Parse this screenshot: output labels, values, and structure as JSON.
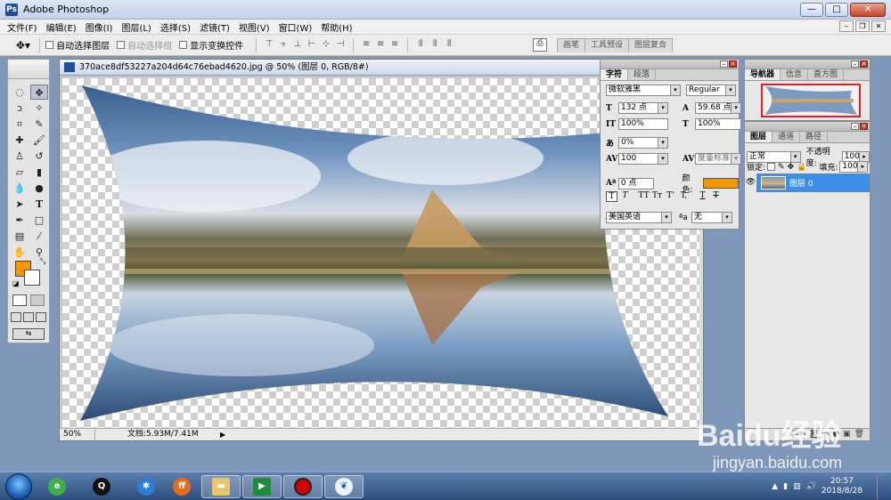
{
  "window": {
    "title": "Adobe Photoshop",
    "min": "—",
    "max": "□",
    "close": "✕"
  },
  "menu": [
    "文件(F)",
    "编辑(E)",
    "图像(I)",
    "图层(L)",
    "选择(S)",
    "滤镜(T)",
    "视图(V)",
    "窗口(W)",
    "帮助(H)"
  ],
  "options": {
    "auto_select_layer": "自动选择图层",
    "auto_select_group": "自动选择组",
    "show_transform": "显示变换控件"
  },
  "wells": [
    "画笔",
    "工具预设",
    "图层复合"
  ],
  "document": {
    "title": "370ace8df53227a204d64c76ebad4620.jpg @ 50% (图层 0, RGB/8#)",
    "zoom": "50%",
    "doc_size": "文档:5.93M/7.41M"
  },
  "character": {
    "tabs": [
      "字符",
      "段落"
    ],
    "font_family": "微软雅黑",
    "font_style": "Regular",
    "font_size": "132 点",
    "leading": "59.68 点",
    "vertical_scale": "100%",
    "horizontal_scale": "100%",
    "kerning": "0%",
    "tracking": "100",
    "kerning_mode": "度量标准",
    "baseline_shift": "0 点",
    "color_label": "颜色:",
    "color": "#f39800",
    "formats": [
      "T",
      "T",
      "TT",
      "Tт",
      "T'",
      "T,",
      "T",
      "T"
    ],
    "language": "美国英语",
    "aa_label": "ªa",
    "antialias": "无"
  },
  "navigator": {
    "tabs": [
      "导航器",
      "信息",
      "直方图"
    ]
  },
  "layers": {
    "tabs": [
      "图层",
      "通道",
      "路径"
    ],
    "blend_mode": "正常",
    "opacity_label": "不透明度:",
    "opacity": "100%",
    "lock_label": "锁定:",
    "fill_label": "填充:",
    "fill": "100%",
    "layer_name": "图层 0"
  },
  "taskbar": {
    "time": "20:57",
    "date": "2018/8/28"
  },
  "watermark": {
    "logo": "Baidu经验",
    "url": "jingyan.baidu.com"
  },
  "colors": {
    "foreground": "#f39800",
    "background": "#ffffff",
    "selection": "#3d8ee6"
  }
}
